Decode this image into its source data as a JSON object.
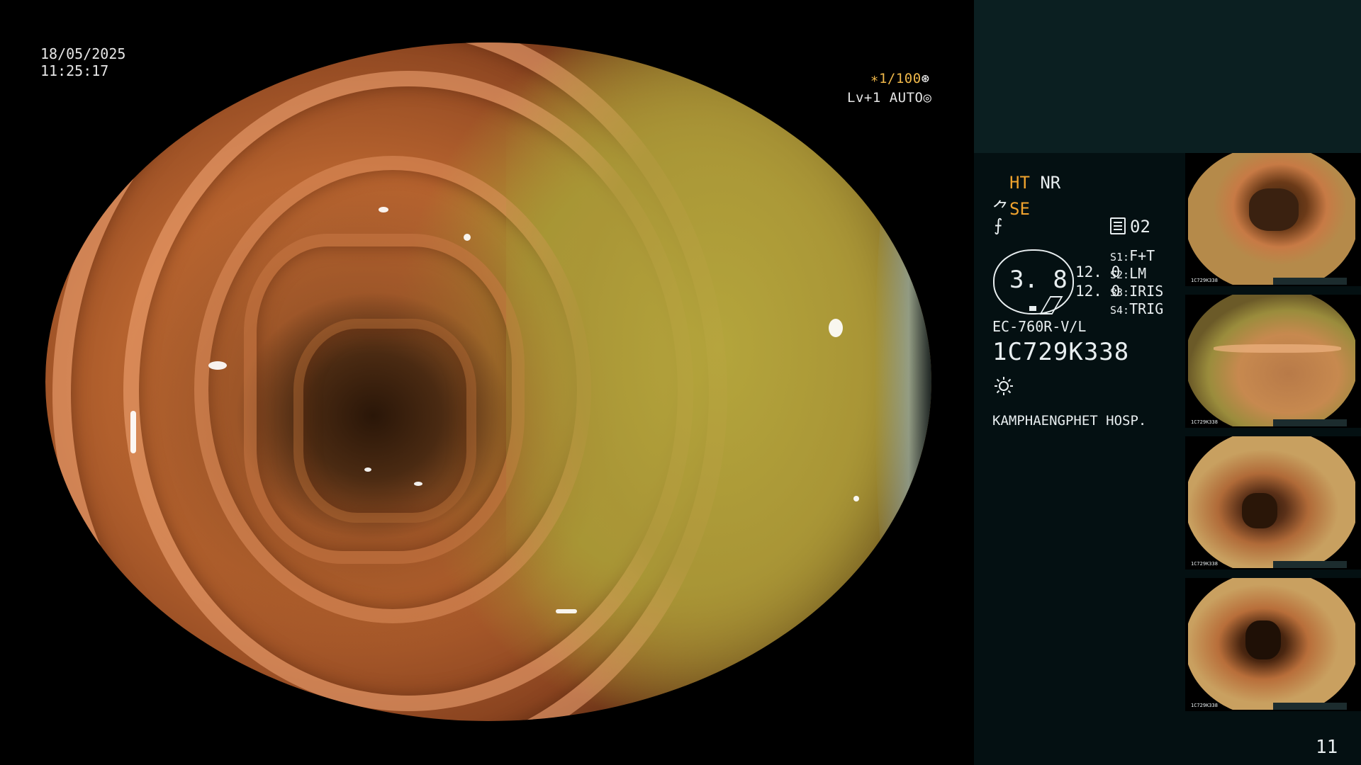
{
  "overlay": {
    "date": "18/05/2025",
    "time": "11:25:17",
    "exposure": "∗1/100",
    "exposure_icon": "shutter-icon",
    "level": "Lv+1 AUTO",
    "level_icon": "auto-iris-icon"
  },
  "panel": {
    "ht_label": "HT",
    "nr_label": "NR",
    "se_prefix": "⺈",
    "se_label": "SE",
    "f_note": "⨍",
    "memory_value": "02",
    "gauge_value": "3. 8",
    "value_1": "12. 0",
    "value_2": "12. 0",
    "switches": [
      {
        "key": "S1:",
        "value": "F+T"
      },
      {
        "key": "S2:",
        "value": "LM"
      },
      {
        "key": "S3:",
        "value": "IRIS"
      },
      {
        "key": "S4:",
        "value": "TRIG"
      }
    ],
    "scope_model": "EC-760R-V/L",
    "scope_serial": "1C729K338",
    "light_icon": "light-source-icon",
    "hospital": "KAMPHAENGPHET HOSP.",
    "page_number": "11"
  },
  "thumbnails": [
    {
      "caption": "1C729K338"
    },
    {
      "caption": "1C729K338"
    },
    {
      "caption": "1C729K338"
    },
    {
      "caption": "1C729K338"
    }
  ],
  "colors": {
    "accent_orange": "#f0a32e",
    "panel_dark": "#041012",
    "panel_top": "#0b1f21"
  }
}
